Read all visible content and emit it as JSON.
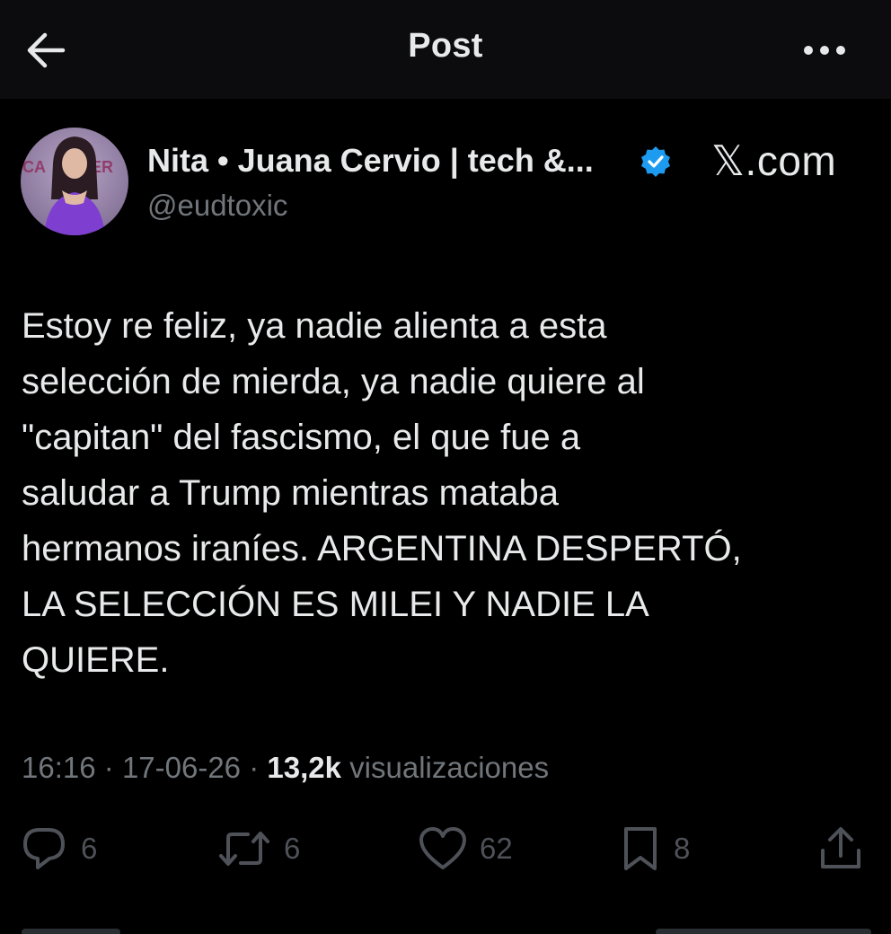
{
  "header": {
    "title": "Post"
  },
  "author": {
    "name": "Nita • Juana Cervio | tech &...",
    "handle": "@eudtoxic",
    "verified": true,
    "verified_color": "#1d9bf0"
  },
  "watermark": "𝕏.com",
  "tweet": {
    "text": "Estoy re feliz, ya nadie alienta a esta\nselección de mierda, ya nadie quiere al\n\"capitan\" del fascismo, el que fue a\nsaludar a Trump mientras mataba\nhermanos iraníes. ARGENTINA DESPERTÓ,\nLA SELECCIÓN ES MILEI Y NADIE LA\nQUIERE.",
    "time": "16:16",
    "date": "17-06-26",
    "views": "13,2k",
    "views_label": "visualizaciones",
    "separator": "·"
  },
  "actions": {
    "replies": "6",
    "reposts": "6",
    "likes": "62",
    "bookmarks": "8"
  },
  "icons": {
    "back": "arrow-left-icon",
    "more": "more-horizontal-icon",
    "verified": "verified-badge-icon",
    "reply": "reply-icon",
    "repost": "repost-icon",
    "like": "heart-icon",
    "bookmark": "bookmark-icon",
    "share": "share-icon"
  }
}
